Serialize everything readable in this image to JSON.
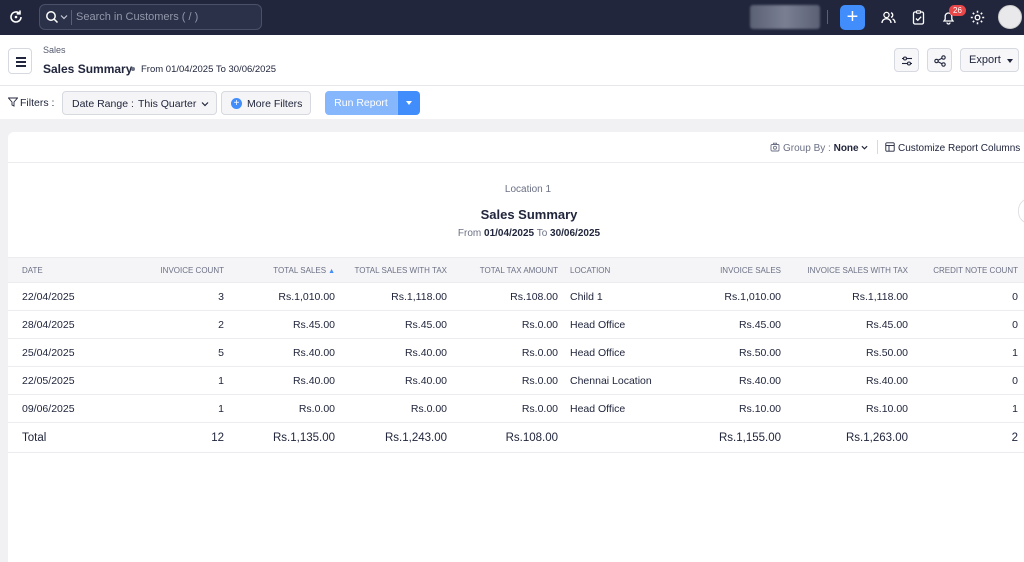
{
  "topbar": {
    "search_placeholder": "Search in Customers ( / )",
    "notification_count": "26",
    "colors": {
      "background": "#21263c",
      "accent": "#408dfb",
      "badge": "#e8474a"
    }
  },
  "header": {
    "module": "Sales",
    "title": "Sales Summary",
    "period": "From 01/04/2025 To 30/06/2025",
    "export_label": "Export"
  },
  "filters": {
    "label": "Filters :",
    "date_range_key": "Date Range :",
    "date_range_value": "This Quarter",
    "more_filters_label": "More Filters",
    "run_report_label": "Run Report"
  },
  "report_toolbar": {
    "group_by_label": "Group By :",
    "group_by_value": "None",
    "customize_label": "Customize Report Columns"
  },
  "report": {
    "location": "Location 1",
    "title": "Sales Summary",
    "period_from_label": "From",
    "period_from": "01/04/2025",
    "period_to_label": "To",
    "period_to": "30/06/2025",
    "columns": [
      "DATE",
      "INVOICE COUNT",
      "TOTAL SALES",
      "TOTAL SALES WITH TAX",
      "TOTAL TAX AMOUNT",
      "LOCATION",
      "INVOICE SALES",
      "INVOICE SALES WITH TAX",
      "CREDIT NOTE COUNT"
    ],
    "rows": [
      [
        "22/04/2025",
        "3",
        "Rs.1,010.00",
        "Rs.1,118.00",
        "Rs.108.00",
        "Child 1",
        "Rs.1,010.00",
        "Rs.1,118.00",
        "0"
      ],
      [
        "28/04/2025",
        "2",
        "Rs.45.00",
        "Rs.45.00",
        "Rs.0.00",
        "Head Office",
        "Rs.45.00",
        "Rs.45.00",
        "0"
      ],
      [
        "25/04/2025",
        "5",
        "Rs.40.00",
        "Rs.40.00",
        "Rs.0.00",
        "Head Office",
        "Rs.50.00",
        "Rs.50.00",
        "1"
      ],
      [
        "22/05/2025",
        "1",
        "Rs.40.00",
        "Rs.40.00",
        "Rs.0.00",
        "Chennai Location",
        "Rs.40.00",
        "Rs.40.00",
        "0"
      ],
      [
        "09/06/2025",
        "1",
        "Rs.0.00",
        "Rs.0.00",
        "Rs.0.00",
        "Head Office",
        "Rs.10.00",
        "Rs.10.00",
        "1"
      ]
    ],
    "total": [
      "Total",
      "12",
      "Rs.1,135.00",
      "Rs.1,243.00",
      "Rs.108.00",
      "",
      "Rs.1,155.00",
      "Rs.1,263.00",
      "2"
    ]
  }
}
